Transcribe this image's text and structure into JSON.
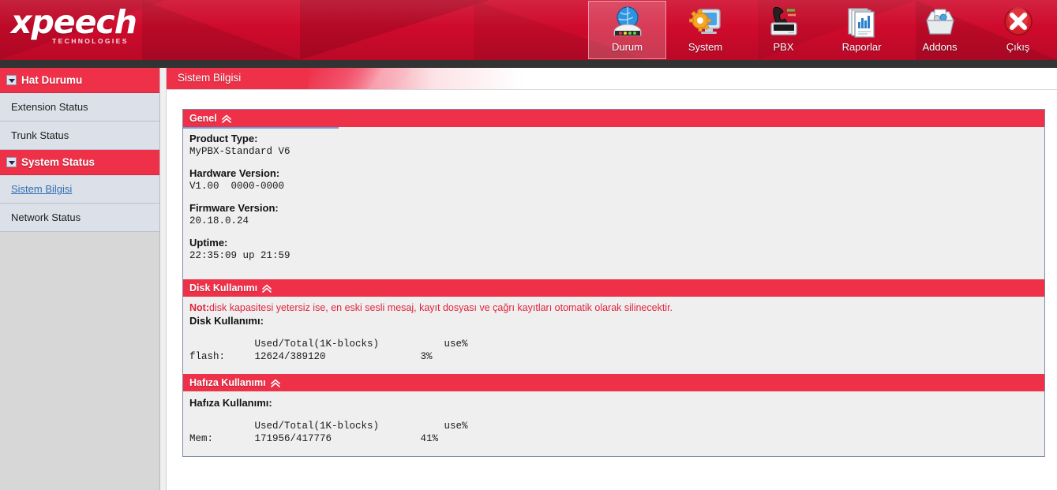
{
  "brand": {
    "word": "xpeech",
    "sub": "TECHNOLOGIES"
  },
  "nav": {
    "items": [
      {
        "label": "Durum",
        "icon": "status-globe-icon",
        "active": true
      },
      {
        "label": "System",
        "icon": "system-gear-monitor-icon",
        "active": false
      },
      {
        "label": "PBX",
        "icon": "pbx-phone-icon",
        "active": false
      },
      {
        "label": "Raporlar",
        "icon": "reports-chart-icon",
        "active": false
      },
      {
        "label": "Addons",
        "icon": "addons-box-icon",
        "active": false
      },
      {
        "label": "Çıkış",
        "icon": "logout-close-icon",
        "active": false
      }
    ]
  },
  "sidebar": {
    "groups": [
      {
        "label": "Hat Durumu",
        "links": [
          {
            "label": "Extension Status",
            "active": false
          },
          {
            "label": "Trunk Status",
            "active": false
          }
        ]
      },
      {
        "label": "System  Status",
        "links": [
          {
            "label": "Sistem Bilgisi",
            "active": true
          },
          {
            "label": "Network Status",
            "active": false
          }
        ]
      }
    ]
  },
  "page": {
    "title": "Sistem Bilgisi"
  },
  "sections": {
    "genel": {
      "title": "Genel",
      "collapse_icon": "«",
      "fields": [
        {
          "label": "Product Type:",
          "value": "MyPBX-Standard V6"
        },
        {
          "label": "Hardware Version:",
          "value": "V1.00  0000-0000"
        },
        {
          "label": "Firmware Version:",
          "value": "20.18.0.24"
        },
        {
          "label": "Uptime:",
          "value": "22:35:09 up 21:59"
        }
      ]
    },
    "disk": {
      "title": "Disk Kullanımı",
      "collapse_icon": "«",
      "note_prefix": "Not:",
      "note_text": "disk kapasitesi yetersiz ise, en eski sesli mesaj, kayıt dosyası ve çağrı kayıtları otomatik olarak silinecektir.",
      "subtitle": "Disk Kullanımı:",
      "table_text": "           Used/Total(1K-blocks)           use%\nflash:     12624/389120                3%"
    },
    "hafiza": {
      "title": "Hafıza Kullanımı",
      "collapse_icon": "«",
      "subtitle": "Hafıza Kullanımı:",
      "table_text": "           Used/Total(1K-blocks)           use%\nMem:       171956/417776               41%"
    }
  },
  "colors": {
    "brand_red": "#cf0a2c",
    "accent_red": "#ee3048",
    "note_red": "#e0243c",
    "link_blue": "#2f6fb5",
    "panel_border": "#7d8aa8",
    "sidebar_item_bg": "#dce0e8"
  }
}
